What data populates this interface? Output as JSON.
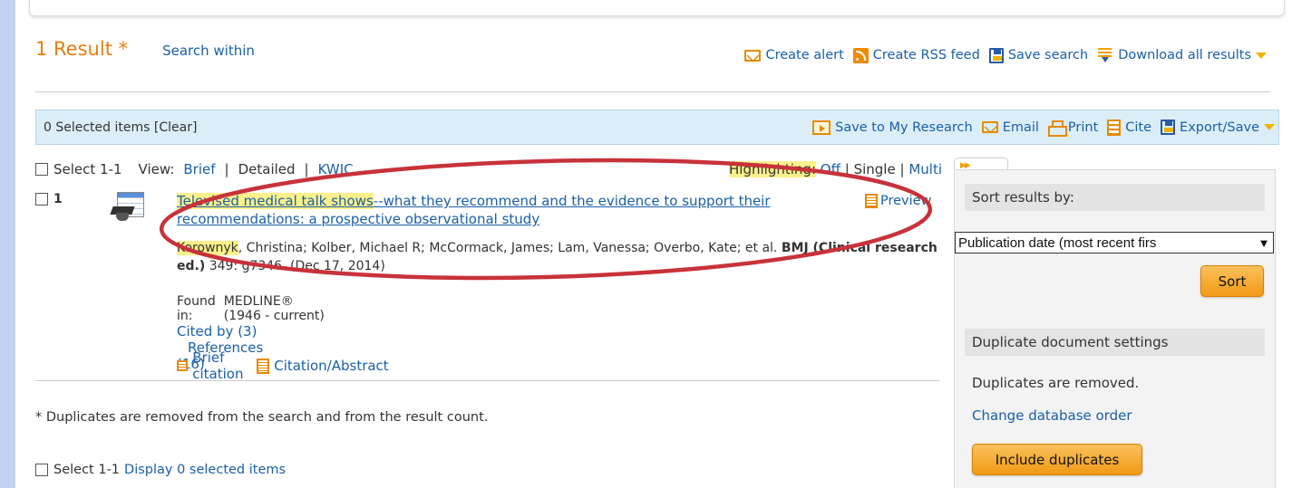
{
  "topbar": {
    "text": ""
  },
  "results": {
    "count_label": "1 Result *",
    "search_within": "Search within"
  },
  "toolbar": {
    "create_alert": "Create alert",
    "create_rss": "Create RSS feed",
    "save_search": "Save search",
    "download_all": "Download all results"
  },
  "selection_bar": {
    "selected_text": "0 Selected items [Clear]",
    "save_my_research": "Save to My Research",
    "email": "Email",
    "print": "Print",
    "cite": "Cite",
    "export_save": "Export/Save"
  },
  "view": {
    "select_range": "Select 1-1",
    "view_label": "View:",
    "brief": "Brief",
    "sep": "|",
    "detailed": "Detailed",
    "kwic": "KWIC",
    "highlighting_label": "Highlighting:",
    "off": "Off",
    "single": "Single",
    "multi": "Multi"
  },
  "record": {
    "number": "1",
    "title_highlight": "Televised medical talk shows",
    "title_rest": "--what they recommend and the evidence to support their recommendations: a prospective observational study",
    "preview": "Preview",
    "author_highlight": "Korownyk",
    "authors_rest": ", Christina; Kolber, Michael R; McCormack, James; Lam, Vanessa; Overbo, Kate; et al.",
    "journal": "BMJ (Clinical research ed.)",
    "citation_rest": "349: g7346. (Dec 17, 2014)",
    "found_label": "Found in:",
    "found_value": "MEDLINE® (1946 - current)",
    "cited_by": "Cited by (3)",
    "references": "References (16)",
    "brief_citation": "Brief citation",
    "citation_abstract": "Citation/Abstract"
  },
  "footnote": "* Duplicates are removed from the search and from the result count.",
  "bottom": {
    "select_range": "Select 1-1",
    "display_selected": "Display 0 selected items"
  },
  "sidebar": {
    "sort_heading": "Sort results by:",
    "sort_options": [
      "Publication date (most recent first)"
    ],
    "sort_selected": "Publication date (most recent firs",
    "sort_button": "Sort",
    "dup_heading": "Duplicate document settings",
    "dup_text": "Duplicates are removed.",
    "change_order": "Change database order",
    "include_duplicates": "Include duplicates"
  },
  "colors": {
    "accent_orange": "#e87d0d",
    "link_blue": "#1a5fa8",
    "highlight_yellow": "#fcf08a",
    "annotation_red": "#c8323a",
    "selection_bar_bg": "#dbeef8"
  }
}
